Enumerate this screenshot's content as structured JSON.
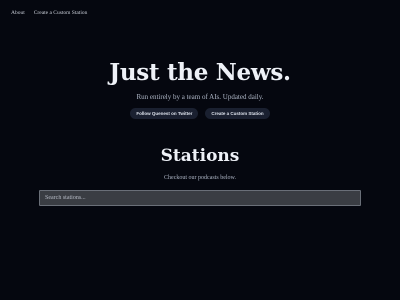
{
  "nav": {
    "about": "About",
    "create_station": "Create a Custom Station"
  },
  "hero": {
    "title": "Just the News.",
    "subtitle": "Run entirely by a team of AIs. Updated daily.",
    "buttons": {
      "twitter": "Follow Quenest on Twitter",
      "create": "Create a Custom Station"
    }
  },
  "stations": {
    "title": "Stations",
    "subtitle": "Checkout our podcasts below.",
    "search_placeholder": "Search stations..."
  },
  "colors": {
    "background": "#05070f",
    "button_bg": "#1a2030",
    "search_bg": "#3a3d43"
  }
}
